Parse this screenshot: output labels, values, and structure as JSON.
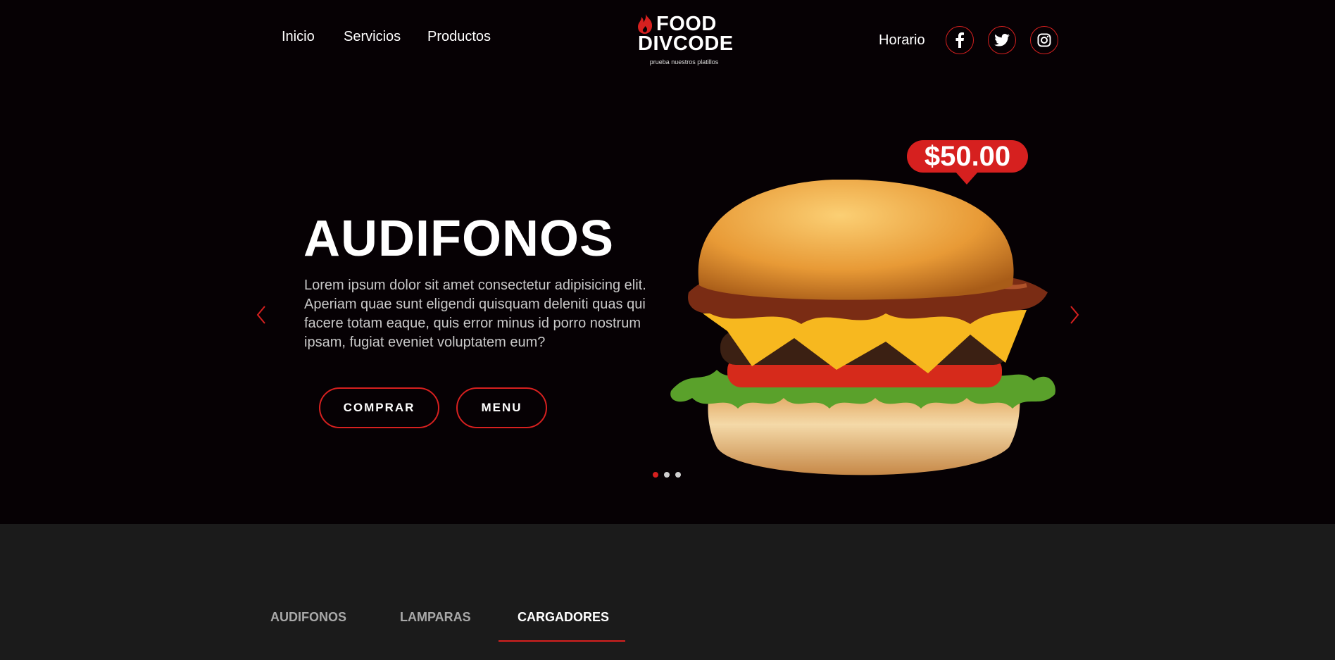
{
  "nav": {
    "items": [
      "Inicio",
      "Servicios",
      "Productos"
    ],
    "schedule": "Horario"
  },
  "logo": {
    "line1": "FOOD",
    "line2": "DIVCODE",
    "tagline": "prueba nuestros platillos"
  },
  "social": {
    "icons": [
      "facebook-icon",
      "twitter-icon",
      "instagram-icon"
    ]
  },
  "hero": {
    "title": "AUDIFONOS",
    "description": "Lorem ipsum dolor sit amet consectetur adipisicing elit. Aperiam quae sunt eligendi quisquam deleniti quas qui facere totam eaque, quis error minus id porro nostrum ipsam, fugiat eveniet voluptatem eum?",
    "buy_label": "COMPRAR",
    "menu_label": "MENU",
    "price": "$50.00",
    "slides": 3,
    "active_slide": 1
  },
  "tabs": {
    "items": [
      "AUDIFONOS",
      "LAMPARAS",
      "CARGADORES"
    ],
    "active_index": 2
  },
  "colors": {
    "accent": "#d6201f",
    "background": "#060104",
    "section": "#1b1b1b"
  }
}
